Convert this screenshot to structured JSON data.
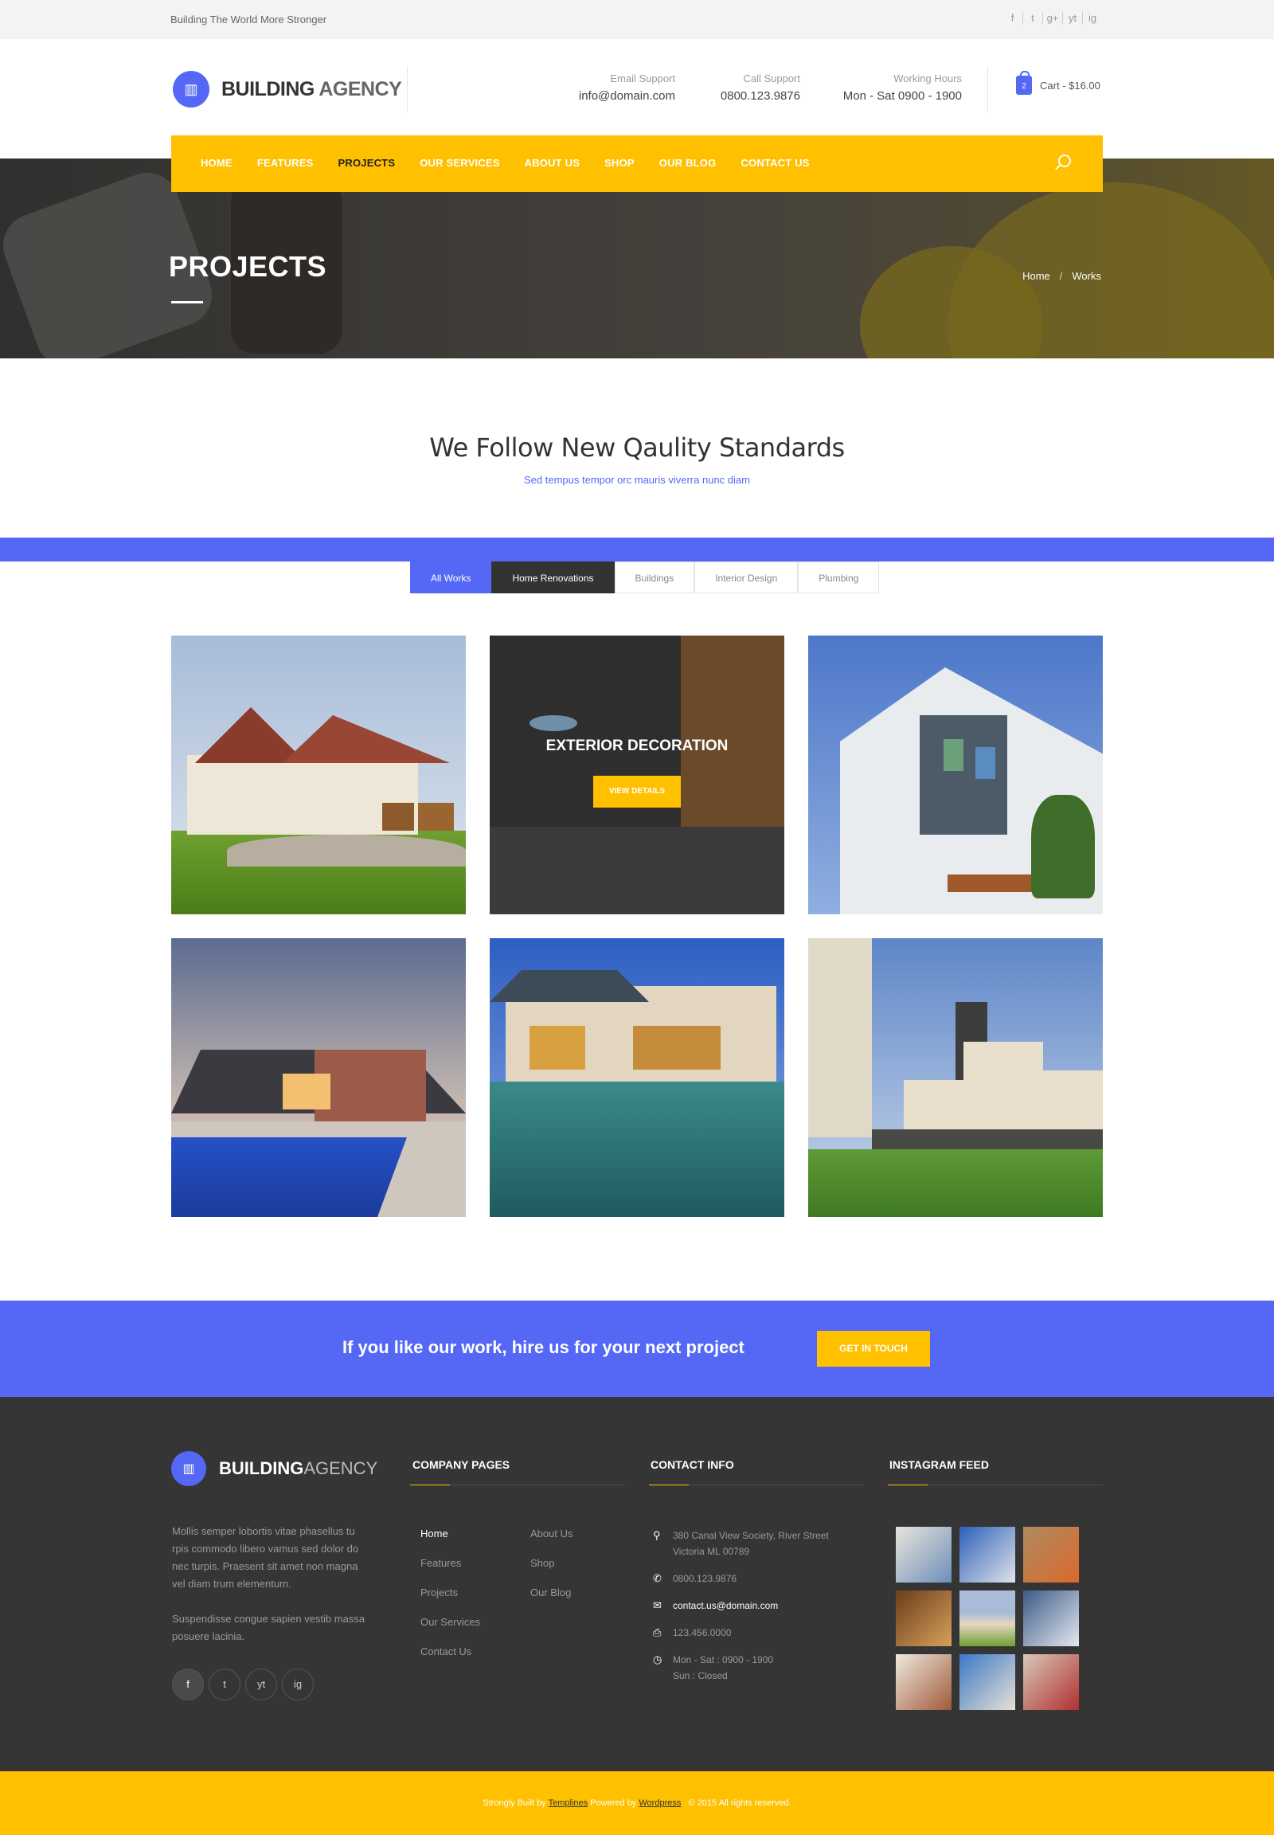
{
  "topbar": {
    "tagline": "Building The World More Stronger",
    "social": [
      "f",
      "t",
      "g+",
      "yt",
      "ig"
    ]
  },
  "header": {
    "logo_bold": "BUILDING",
    "logo_thin": "AGENCY",
    "email_label": "Email Support",
    "email_value": "info@domain.com",
    "call_label": "Call Support",
    "call_value": "0800.123.9876",
    "hours_label": "Working Hours",
    "hours_value": "Mon - Sat 0900 - 1900",
    "cart_count": "2",
    "cart_text": "Cart - $16.00"
  },
  "nav": {
    "items": [
      "HOME",
      "FEATURES",
      "PROJECTS",
      "OUR SERVICES",
      "ABOUT US",
      "SHOP",
      "OUR BLOG",
      "CONTACT US"
    ]
  },
  "banner": {
    "title": "PROJECTS",
    "crumb_home": "Home",
    "crumb_sep": "/",
    "crumb_current": "Works"
  },
  "section": {
    "title": "We Follow New Qaulity Standards",
    "subtitle": "Sed tempus tempor orc mauris viverra nunc diam"
  },
  "filters": [
    "All Works",
    "Home Renovations",
    "Buildings",
    "Interior Design",
    "Plumbing"
  ],
  "projects": {
    "hover_title": "EXTERIOR DECORATION",
    "hover_button": "VIEW DETAILS"
  },
  "cta": {
    "text": "If you like our work, hire us for your next project",
    "button": "GET IN TOUCH"
  },
  "footer": {
    "logo_bold": "BUILDING",
    "logo_thin": "AGENCY",
    "about_p1": "Mollis semper lobortis vitae phasellus tu rpis commodo libero vamus sed dolor do nec turpis. Praesent sit amet non magna vel diam trum elementum.",
    "about_p2": "Suspendisse congue sapien vestib massa posuere lacinia.",
    "social": [
      "f",
      "t",
      "yt",
      "ig"
    ],
    "pages_title": "COMPANY PAGES",
    "pages_col1": [
      "Home",
      "Features",
      "Projects",
      "Our Services",
      "Contact Us"
    ],
    "pages_col2": [
      "About Us",
      "Shop",
      "Our Blog"
    ],
    "contact_title": "CONTACT INFO",
    "address_line1": "380 Canal View Society, River Street",
    "address_line2": "Victoria ML 00789",
    "phone": "0800.123.9876",
    "email": "contact.us@domain.com",
    "fax": "123.456.0000",
    "hours_line1": "Mon - Sat : 0900 - 1900",
    "hours_line2": "Sun : Closed",
    "instagram_title": "INSTAGRAM FEED"
  },
  "bottombar": {
    "prefix": "Strongly Built by",
    "brand": "Templines",
    "mid": "Powered by",
    "platform": "Wordpress",
    "copyright": "© 2015 All rights reserved."
  }
}
